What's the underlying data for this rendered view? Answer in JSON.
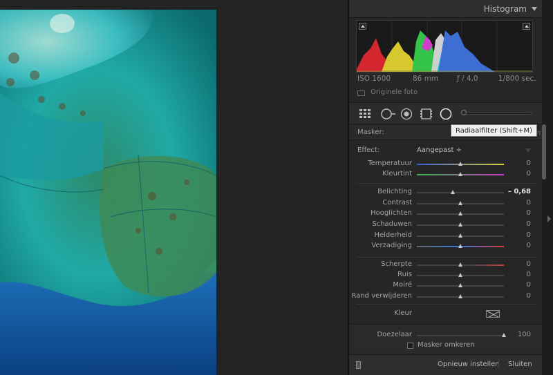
{
  "histogram": {
    "title": "Histogram",
    "exif": {
      "iso": "ISO 1600",
      "focal_length": "86 mm",
      "aperture": "ƒ / 4,0",
      "shutter": "1/800 sec."
    },
    "original_photo_label": "Originele foto"
  },
  "tooltip": "Radiaalfilter (Shift+M)",
  "tools": [
    "grid-icon",
    "spot-removal-icon",
    "red-eye-icon",
    "graduated-filter-icon",
    "radial-filter-icon"
  ],
  "mask": {
    "label": "Masker:",
    "hidden_text": "len"
  },
  "effect": {
    "label": "Effect:",
    "value": "Aangepast ÷"
  },
  "sliders": [
    {
      "label": "Temperatuur",
      "value": "0",
      "pos": 0.5,
      "gradient": "linear-gradient(90deg,#3a5ad8,#d8d23a)"
    },
    {
      "label": "Kleurtint",
      "value": "0",
      "pos": 0.5,
      "gradient": "linear-gradient(90deg,#3ab84a,#c83ac8)"
    },
    {
      "label": "Belichting",
      "value": "– 0,68",
      "pos": 0.415,
      "bold": true
    },
    {
      "label": "Contrast",
      "value": "0",
      "pos": 0.5
    },
    {
      "label": "Hooglichten",
      "value": "0",
      "pos": 0.5
    },
    {
      "label": "Schaduwen",
      "value": "0",
      "pos": 0.5
    },
    {
      "label": "Helderheid",
      "value": "0",
      "pos": 0.5
    },
    {
      "label": "Verzadiging",
      "value": "0",
      "pos": 0.5,
      "gradient": "linear-gradient(90deg,#6a6a6a,#3a7ad8,#d83a3a)"
    },
    {
      "label": "Scherpte",
      "value": "0",
      "pos": 0.5,
      "gradient": "linear-gradient(90deg,#444,#444 60%,#c84040)"
    },
    {
      "label": "Ruis",
      "value": "0",
      "pos": 0.5
    },
    {
      "label": "Moiré",
      "value": "0",
      "pos": 0.5
    },
    {
      "label": "Rand verwijderen",
      "value": "0",
      "pos": 0.5
    }
  ],
  "color": {
    "label": "Kleur"
  },
  "feather": {
    "label": "Doezelaar",
    "value": "100",
    "pos": 1.0
  },
  "invert_mask": {
    "label": "Masker omkeren",
    "checked": false
  },
  "footer": {
    "reset": "Opnieuw instellen",
    "close": "Sluiten"
  }
}
